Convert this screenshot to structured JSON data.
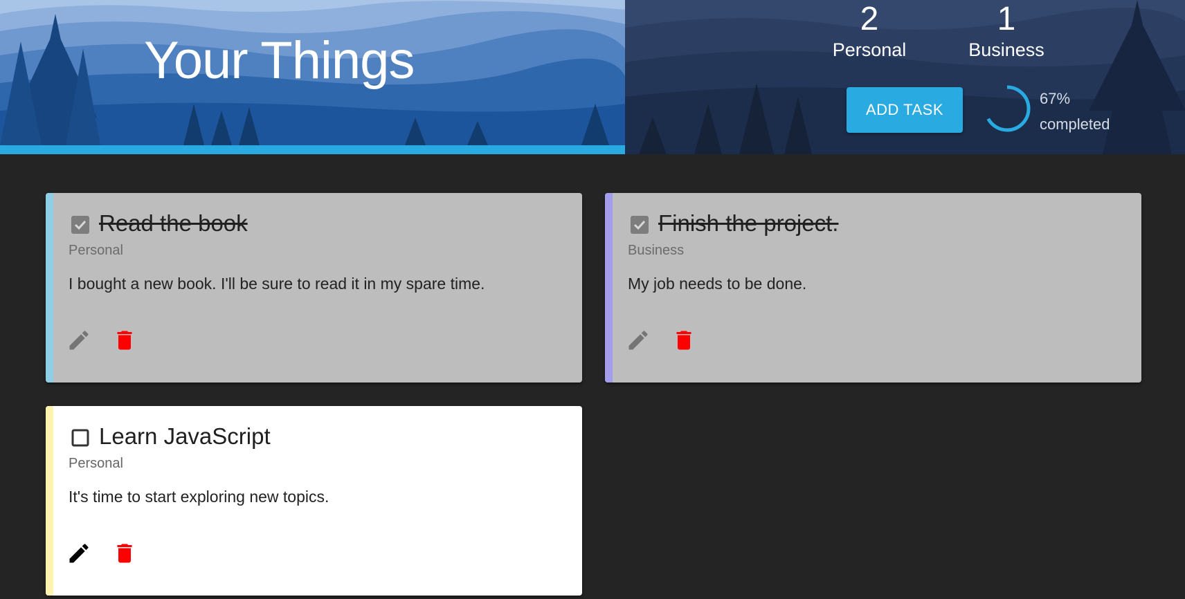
{
  "header": {
    "title": "Your Things",
    "stats": {
      "personal_count": "2",
      "personal_label": "Personal",
      "business_count": "1",
      "business_label": "Business"
    },
    "add_task_label": "ADD TASK",
    "progress": {
      "percent": 67,
      "percent_label": "67%",
      "caption": "completed"
    }
  },
  "tasks": [
    {
      "title": "Read the book",
      "category": "Personal",
      "description": "I bought a new book. I'll be sure to read it in my spare time.",
      "completed": true,
      "accent_color": "#8ecfe6"
    },
    {
      "title": "Finish the project.",
      "category": "Business",
      "description": "My job needs to be done.",
      "completed": true,
      "accent_color": "#a49ded"
    },
    {
      "title": "Learn JavaScript",
      "category": "Personal",
      "description": "It's time to start exploring new topics.",
      "completed": false,
      "accent_color": "#fff3b0"
    }
  ],
  "icons": {
    "checked": "checkbox-checked-icon",
    "unchecked": "checkbox-unchecked-icon",
    "edit": "pencil-icon",
    "delete": "trash-icon"
  },
  "colors": {
    "accent": "#29aae1",
    "delete": "#ff0000",
    "background": "#242424",
    "card_done": "#bdbdbd",
    "card_todo": "#ffffff"
  }
}
